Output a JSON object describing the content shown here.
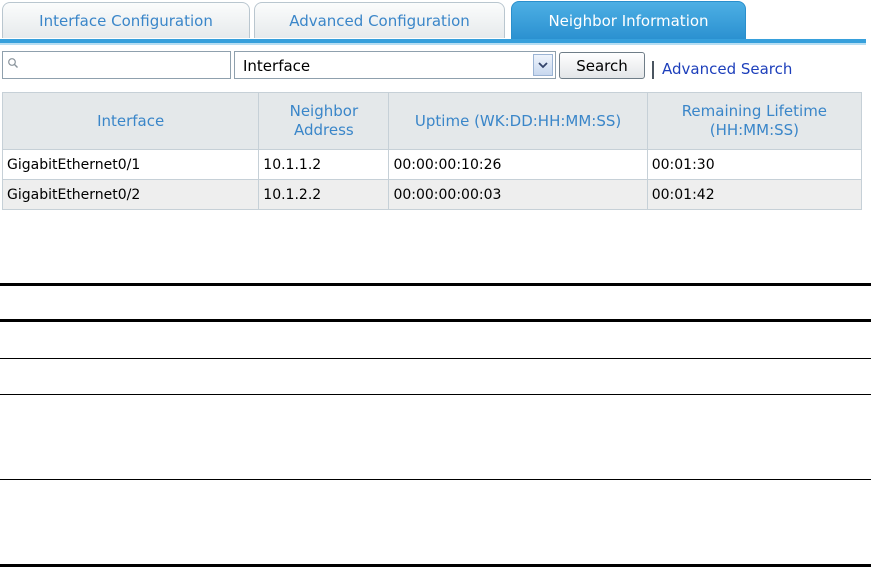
{
  "tabs": [
    {
      "label": "Interface Configuration",
      "active": false
    },
    {
      "label": "Advanced Configuration",
      "active": false
    },
    {
      "label": "Neighbor Information",
      "active": true
    }
  ],
  "search": {
    "value": "",
    "placeholder": "",
    "field_selected": "Interface",
    "button_label": "Search",
    "advanced_link": "Advanced Search"
  },
  "table": {
    "headers": [
      "Interface",
      "Neighbor Address",
      "Uptime (WK:DD:HH:MM:SS)",
      "Remaining Lifetime (HH:MM:SS)"
    ],
    "rows": [
      [
        "GigabitEthernet0/1",
        "10.1.1.2",
        "00:00:00:10:26",
        "00:01:30"
      ],
      [
        "GigabitEthernet0/2",
        "10.1.2.2",
        "00:00:00:00:03",
        "00:01:42"
      ]
    ]
  },
  "colors": {
    "tab_active": "#37a0dc",
    "tab_text": "#3a86c9",
    "link": "#1d3fbb",
    "header_bg": "#e4e8ea",
    "row_alt_bg": "#eeeeee"
  },
  "icons": {
    "search_field": "magnifier-icon",
    "select_arrow": "chevron-down-icon"
  }
}
